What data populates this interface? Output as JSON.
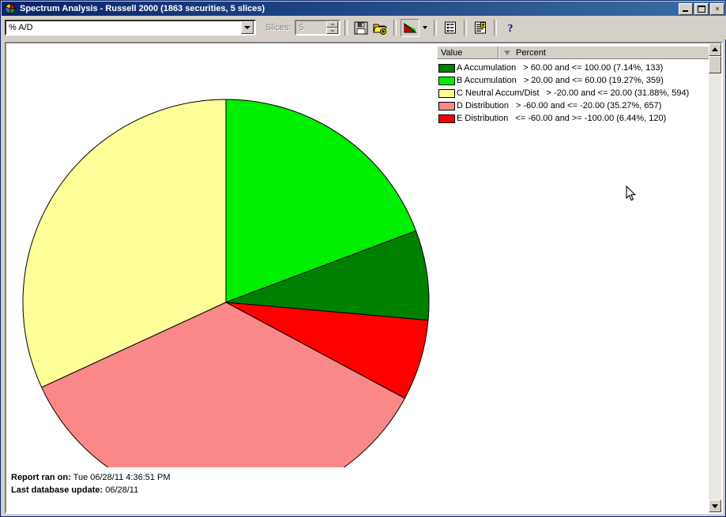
{
  "window": {
    "title": "Spectrum Analysis - Russell 2000 (1863 securities, 5 slices)",
    "icon": "pie-chart-icon",
    "minimize_label": "",
    "maximize_label": "",
    "close_label": "×"
  },
  "toolbar": {
    "field_selector_value": "% A/D",
    "slices_label": "Slices:",
    "slices_value": "5",
    "buttons": [
      {
        "name": "save-button",
        "icon": "floppy-disk-icon"
      },
      {
        "name": "open-button",
        "icon": "open-folder-icon"
      },
      {
        "name": "pie-chart-view-button",
        "icon": "pie-chart-icon"
      },
      {
        "name": "chart-type-dropdown",
        "icon": "chevron-down-icon"
      },
      {
        "name": "list-report-button",
        "icon": "list-report-icon"
      },
      {
        "name": "new-report-button",
        "icon": "report-plus-icon"
      },
      {
        "name": "help-button",
        "icon": "question-mark-icon"
      }
    ]
  },
  "legend": {
    "columns": [
      {
        "label": "Value"
      },
      {
        "label": "Percent",
        "sort": "descending"
      }
    ],
    "rows": [
      {
        "key": "A",
        "label": "A Accumulation",
        "range": "> 60.00 and <= 100.00 (7.14%, 133)",
        "color": "#008000",
        "percent": 7.14,
        "count": 133
      },
      {
        "key": "B",
        "label": "B Accumulation",
        "range": "> 20.00 and <= 60.00 (19.27%, 359)",
        "color": "#00ee00",
        "percent": 19.27,
        "count": 359
      },
      {
        "key": "C",
        "label": "C Neutral Accum/Dist",
        "range": "> -20.00 and <= 20.00 (31.88%, 594)",
        "color": "#ffff99",
        "percent": 31.88,
        "count": 594
      },
      {
        "key": "D",
        "label": "D Distribution",
        "range": "> -60.00 and <= -20.00 (35.27%, 657)",
        "color": "#fa8888",
        "percent": 35.27,
        "count": 657
      },
      {
        "key": "E",
        "label": "E Distribution",
        "range": "<= -60.00 and >= -100.00 (6.44%, 120)",
        "color": "#ff0000",
        "percent": 6.44,
        "count": 120
      }
    ]
  },
  "chart_data": {
    "type": "pie",
    "title": "Spectrum Analysis - Russell 2000",
    "categories": [
      "B Accumulation",
      "A Accumulation",
      "E Distribution",
      "D Distribution",
      "C Neutral Accum/Dist"
    ],
    "values": [
      19.27,
      7.14,
      6.44,
      35.27,
      31.88
    ],
    "counts": [
      359,
      133,
      120,
      657,
      594
    ],
    "colors": [
      "#00ee00",
      "#008000",
      "#ff0000",
      "#fa8888",
      "#ffff99"
    ],
    "start_angle_deg": 0,
    "direction": "clockwise",
    "total_securities": 1863,
    "slices": 5,
    "legend_position": "top-right",
    "grid": false,
    "xlabel": "",
    "ylabel": ""
  },
  "footer": {
    "report_ran_label": "Report ran on:",
    "report_ran_value": "Tue 06/28/11 4:36:51 PM",
    "last_update_label": "Last database update:",
    "last_update_value": "06/28/11"
  }
}
